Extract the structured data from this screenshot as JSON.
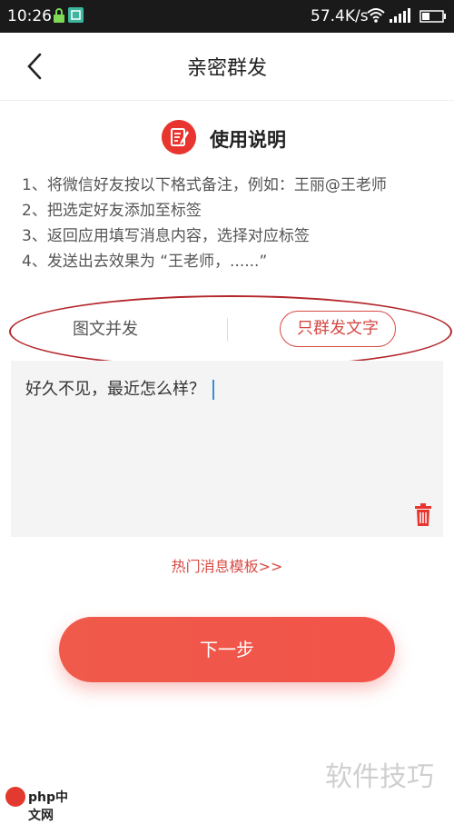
{
  "status_bar": {
    "time": "10:26",
    "speed": "57.4K/s"
  },
  "header": {
    "title": "亲密群发"
  },
  "instructions": {
    "title": "使用说明",
    "steps": [
      "1、将微信好友按以下格式备注，例如：王丽@王老师",
      "2、把选定好友添加至标签",
      "3、返回应用填写消息内容，选择对应标签",
      "4、发送出去效果为 “王老师，......”"
    ]
  },
  "modes": {
    "option_a": "图文并发",
    "option_b": "只群发文字",
    "selected": "option_b"
  },
  "message": {
    "value": "好久不见，最近怎么样？"
  },
  "templates_link": "热门消息模板>>",
  "next_button": "下一步",
  "watermark": "软件技巧",
  "brand": "php中文网",
  "colors": {
    "accent": "#e8352f",
    "button": "#ef5a4a",
    "annotation": "#b3272c"
  }
}
